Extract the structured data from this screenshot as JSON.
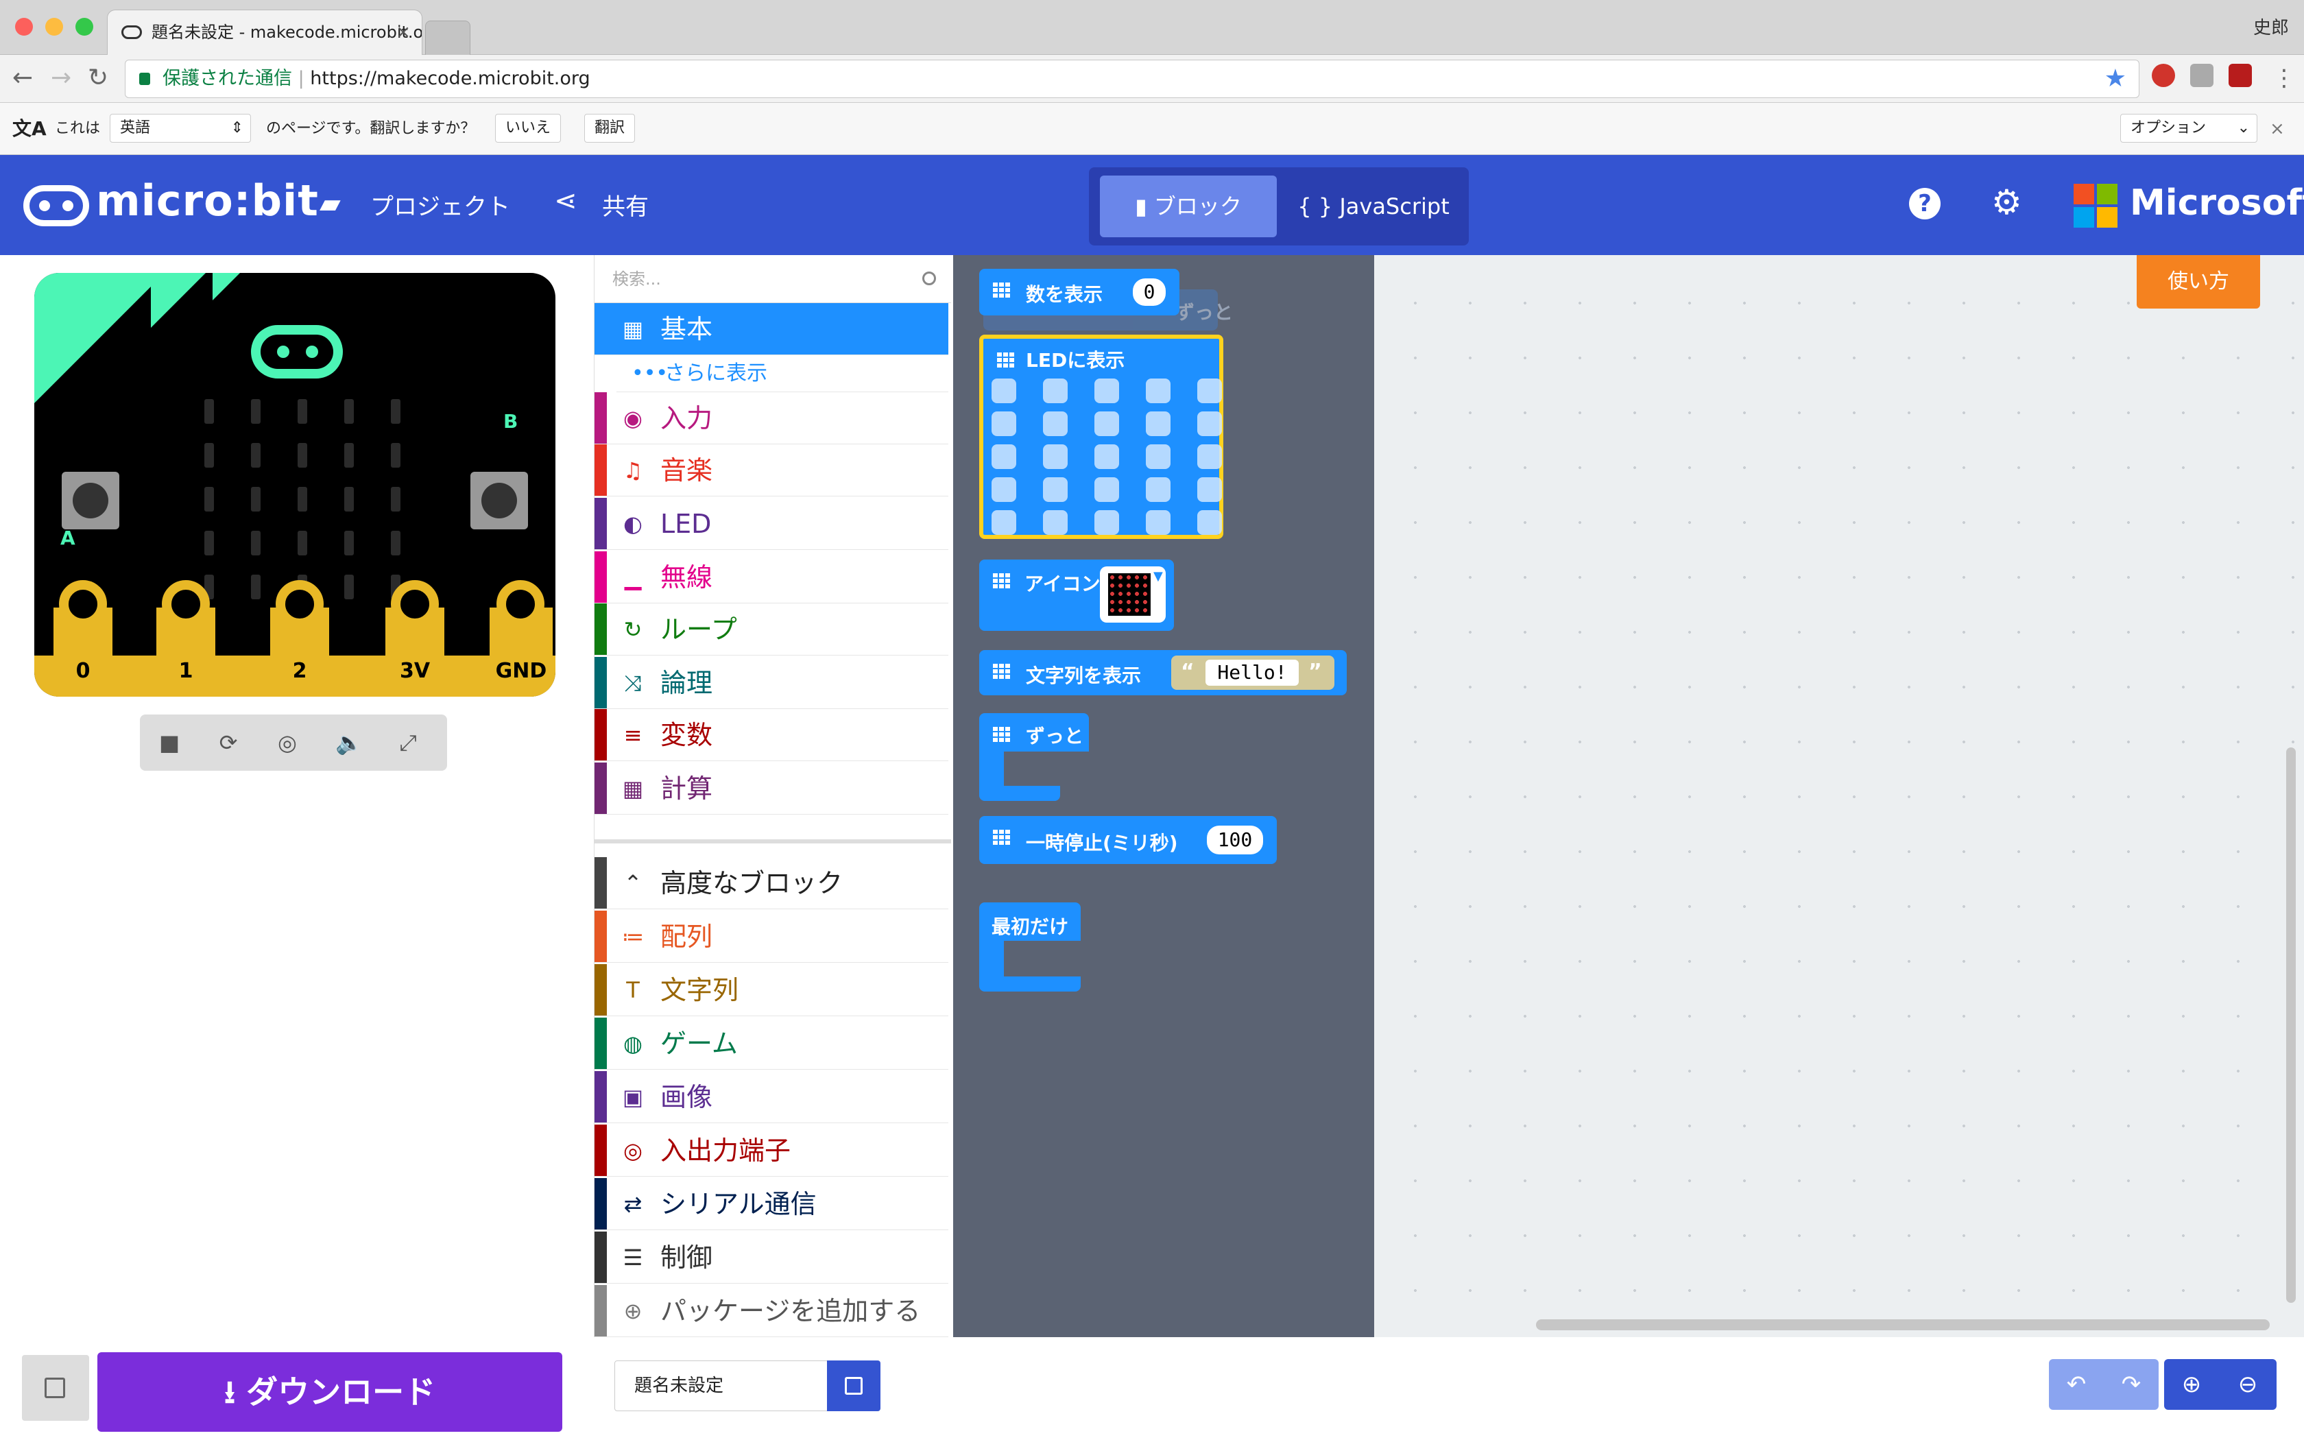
{
  "browser": {
    "tab_title": "題名未設定 - makecode.microbit.org",
    "user_name": "史郎",
    "secure_label": "保護された通信",
    "url": "https://makecode.microbit.org"
  },
  "translate_bar": {
    "prefix": "これは",
    "language": "英語",
    "question": "のページです。翻訳しますか？",
    "no_label": "いいえ",
    "translate_label": "翻訳",
    "options_label": "オプション"
  },
  "header": {
    "brand": "micro:bit",
    "projects_label": "プロジェクト",
    "share_label": "共有",
    "mode_blocks": "ブロック",
    "mode_js": "JavaScript",
    "ms_brand": "Microsoft"
  },
  "simulator": {
    "pins": [
      "0",
      "1",
      "2",
      "3V",
      "GND"
    ],
    "button_a": "A",
    "button_b": "B"
  },
  "toolbox": {
    "search_placeholder": "検索...",
    "more_label": "さらに表示",
    "categories": [
      {
        "label": "基本",
        "color": "#1e90ff"
      },
      {
        "label": "入力",
        "color": "#b7197f"
      },
      {
        "label": "音楽",
        "color": "#e63022"
      },
      {
        "label": "LED",
        "color": "#5c2d91"
      },
      {
        "label": "無線",
        "color": "#e3008c"
      },
      {
        "label": "ループ",
        "color": "#107c10"
      },
      {
        "label": "論理",
        "color": "#006970"
      },
      {
        "label": "変数",
        "color": "#a80000"
      },
      {
        "label": "計算",
        "color": "#712672"
      }
    ],
    "advanced_label": "高度なブロック",
    "advanced": [
      {
        "label": "配列",
        "color": "#e65722"
      },
      {
        "label": "文字列",
        "color": "#996600"
      },
      {
        "label": "ゲーム",
        "color": "#007a4b"
      },
      {
        "label": "画像",
        "color": "#5c2d91"
      },
      {
        "label": "入出力端子",
        "color": "#a80000"
      },
      {
        "label": "シリアル通信",
        "color": "#002050"
      },
      {
        "label": "制御",
        "color": "#333333"
      }
    ],
    "add_package_label": "パッケージを追加する"
  },
  "flyout": {
    "show_number": "数を表示",
    "show_number_value": "0",
    "show_leds": "LEDに表示",
    "show_icon": "アイコン",
    "show_string": "文字列を表示",
    "show_string_value": "Hello!",
    "forever": "ずっと",
    "ghost_forever": "ずっと",
    "pause": "一時停止(ミリ秒)",
    "pause_value": "100",
    "on_start": "最初だけ"
  },
  "workspace": {
    "help_label": "使い方"
  },
  "footer": {
    "download_label": "ダウンロード",
    "project_name": "題名未設定"
  },
  "colors": {
    "header": "#3454d1",
    "download": "#7b2ddb",
    "help": "#f5821f",
    "block_basic": "#1e90ff"
  }
}
